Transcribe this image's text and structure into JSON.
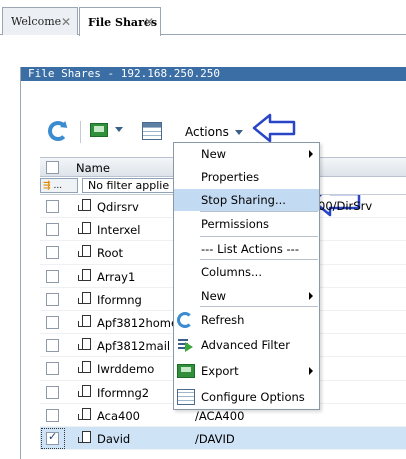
{
  "tabs": [
    {
      "label": "Welcome",
      "close": "✕"
    },
    {
      "label": "File Shares",
      "close": "✕"
    }
  ],
  "panel": {
    "title": "File Shares - 192.168.250.250"
  },
  "toolbar": {
    "actions_label": "Actions"
  },
  "table": {
    "header_name": "Name",
    "filter_placeholder": "No filter applie",
    "filter_button": "...",
    "rows": [
      {
        "name": "Qdirsrv",
        "path": "",
        "checked": false
      },
      {
        "name": "Interxel",
        "path": "",
        "checked": false
      },
      {
        "name": "Root",
        "path": "",
        "checked": false
      },
      {
        "name": "Array1",
        "path": "",
        "checked": false
      },
      {
        "name": "Iformng",
        "path": "",
        "checked": false
      },
      {
        "name": "Apf3812home",
        "path": "",
        "checked": false
      },
      {
        "name": "Apf3812mail",
        "path": "",
        "checked": false
      },
      {
        "name": "Iwrddemo",
        "path": "",
        "checked": false
      },
      {
        "name": "Iformng2",
        "path": "",
        "checked": false
      },
      {
        "name": "Aca400",
        "path": "/ACA400",
        "checked": false
      },
      {
        "name": "David",
        "path": "/DAVID",
        "checked": true
      }
    ],
    "partial_path_text": "00/DirSrv"
  },
  "menu": {
    "items": [
      {
        "label": "New",
        "submenu": true
      },
      {
        "label": "Properties",
        "submenu": false
      },
      {
        "label": "Stop Sharing...",
        "submenu": false,
        "highlighted": true
      },
      {
        "label": "Permissions",
        "submenu": false
      },
      {
        "label": "--- List Actions ---",
        "submenu": false
      },
      {
        "label": "Columns...",
        "submenu": false
      },
      {
        "label": "New",
        "submenu": true
      },
      {
        "label": "Refresh",
        "submenu": false,
        "icon": "refresh-icon"
      },
      {
        "label": "Advanced Filter",
        "submenu": false,
        "icon": "advanced-filter-icon"
      },
      {
        "label": "Export",
        "submenu": true,
        "icon": "export-icon"
      },
      {
        "label": "Configure Options",
        "submenu": false,
        "icon": "configure-options-icon"
      }
    ]
  },
  "colors": {
    "title_bar": "#3a6ea5",
    "highlight": "#c3daf3",
    "selected_row": "#cfe3f7",
    "annotation_arrow": "#2a44c8"
  }
}
